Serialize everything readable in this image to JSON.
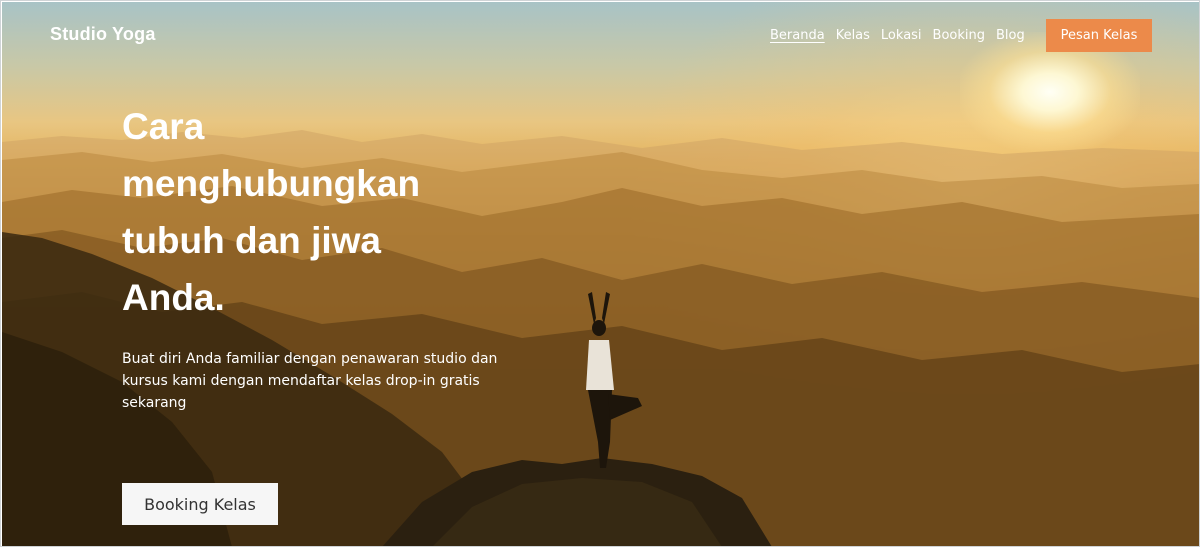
{
  "brand": "Studio Yoga",
  "nav": {
    "items": [
      {
        "label": "Beranda",
        "active": true
      },
      {
        "label": "Kelas",
        "active": false
      },
      {
        "label": "Lokasi",
        "active": false
      },
      {
        "label": "Booking",
        "active": false
      },
      {
        "label": "Blog",
        "active": false
      }
    ],
    "cta_label": "Pesan Kelas"
  },
  "hero": {
    "headline_lines": [
      "Cara",
      "menghubungkan",
      "tubuh dan jiwa",
      "Anda."
    ],
    "subtext": "Buat diri Anda familiar dengan penawaran studio dan kursus kami dengan mendaftar kelas drop-in gratis sekarang",
    "cta_label": "Booking Kelas"
  },
  "colors": {
    "accent": "#ec8a4a",
    "text_light": "#ffffff",
    "button_light": "#f6f6f6"
  }
}
